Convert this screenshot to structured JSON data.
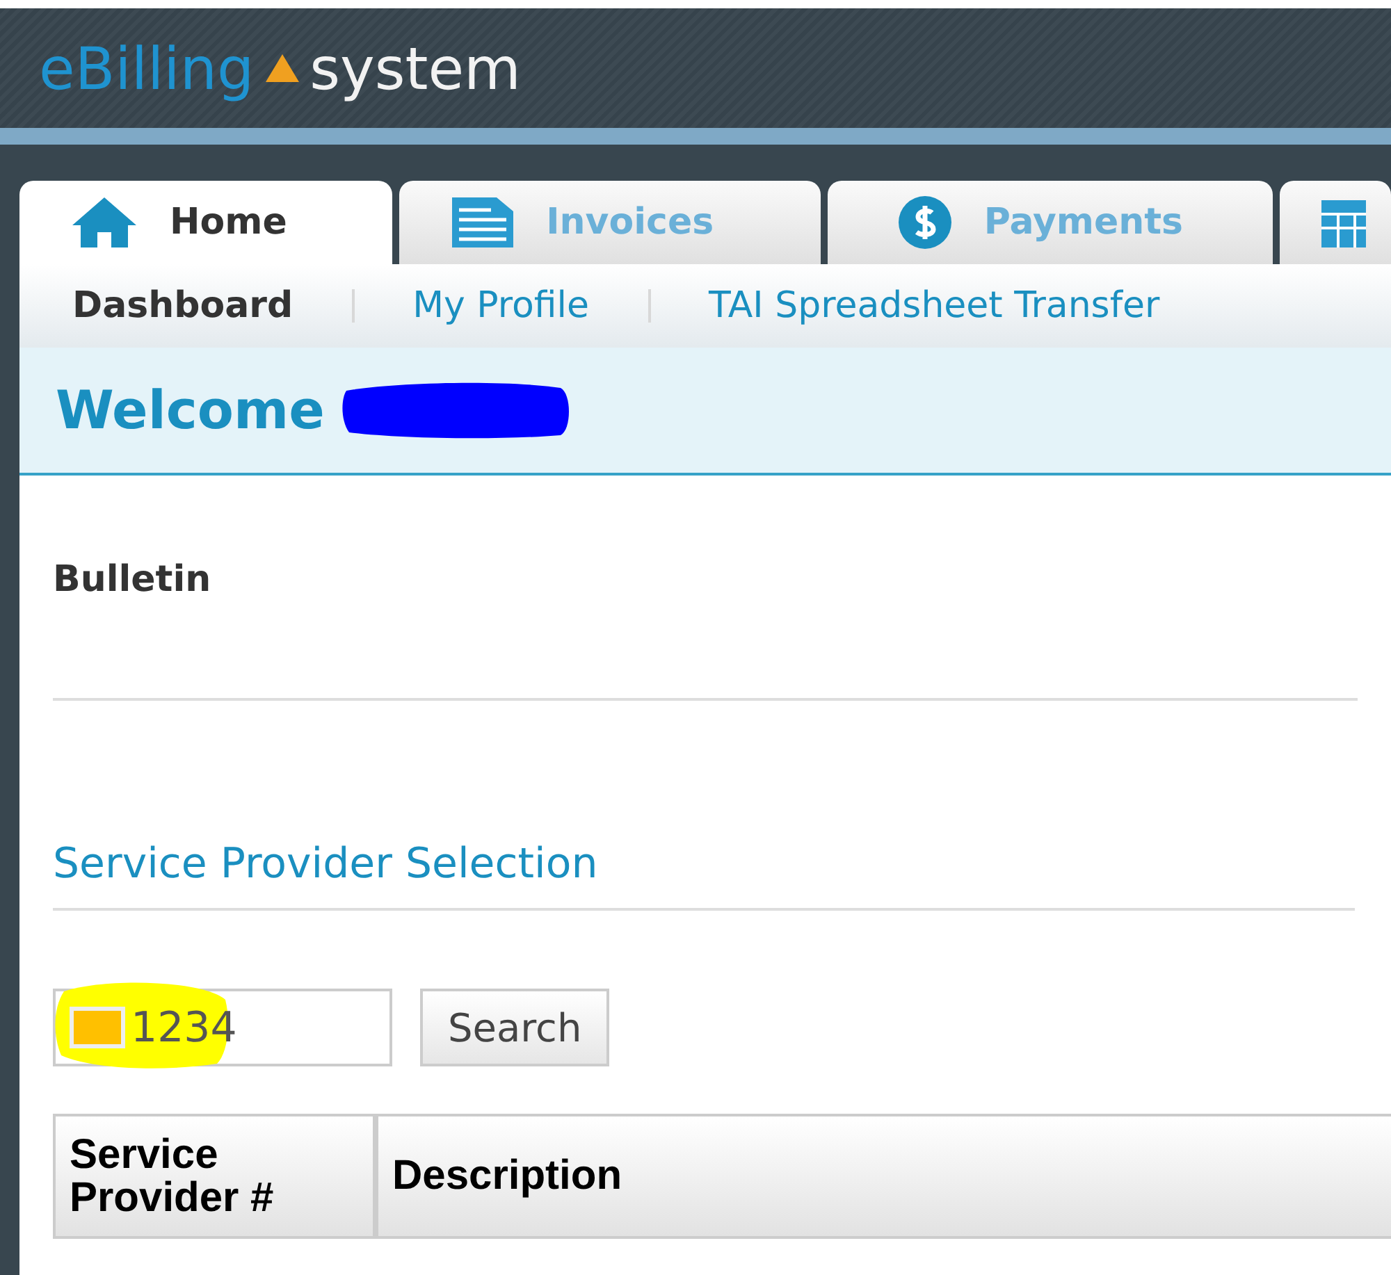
{
  "logo": {
    "brand": "eBilling",
    "product": "system"
  },
  "tabs": [
    {
      "label": "Home",
      "kind": "house",
      "selected": true
    },
    {
      "label": "Invoices",
      "kind": "document",
      "selected": false
    },
    {
      "label": "Payments",
      "kind": "dollar",
      "selected": false
    },
    {
      "kind": "grid",
      "selected": false
    }
  ],
  "subnav": [
    {
      "label": "Dashboard",
      "selected": true
    },
    {
      "label": "My Profile",
      "selected": false
    },
    {
      "label": "TAI Spreadsheet Transfer",
      "selected": false
    }
  ],
  "welcome": "Welcome",
  "bulletin": "Bulletin",
  "section_title": "Service Provider Selection",
  "search": {
    "value": "1234",
    "button": "Search"
  },
  "table": {
    "columns": [
      "Service Provider #",
      "Description"
    ]
  }
}
